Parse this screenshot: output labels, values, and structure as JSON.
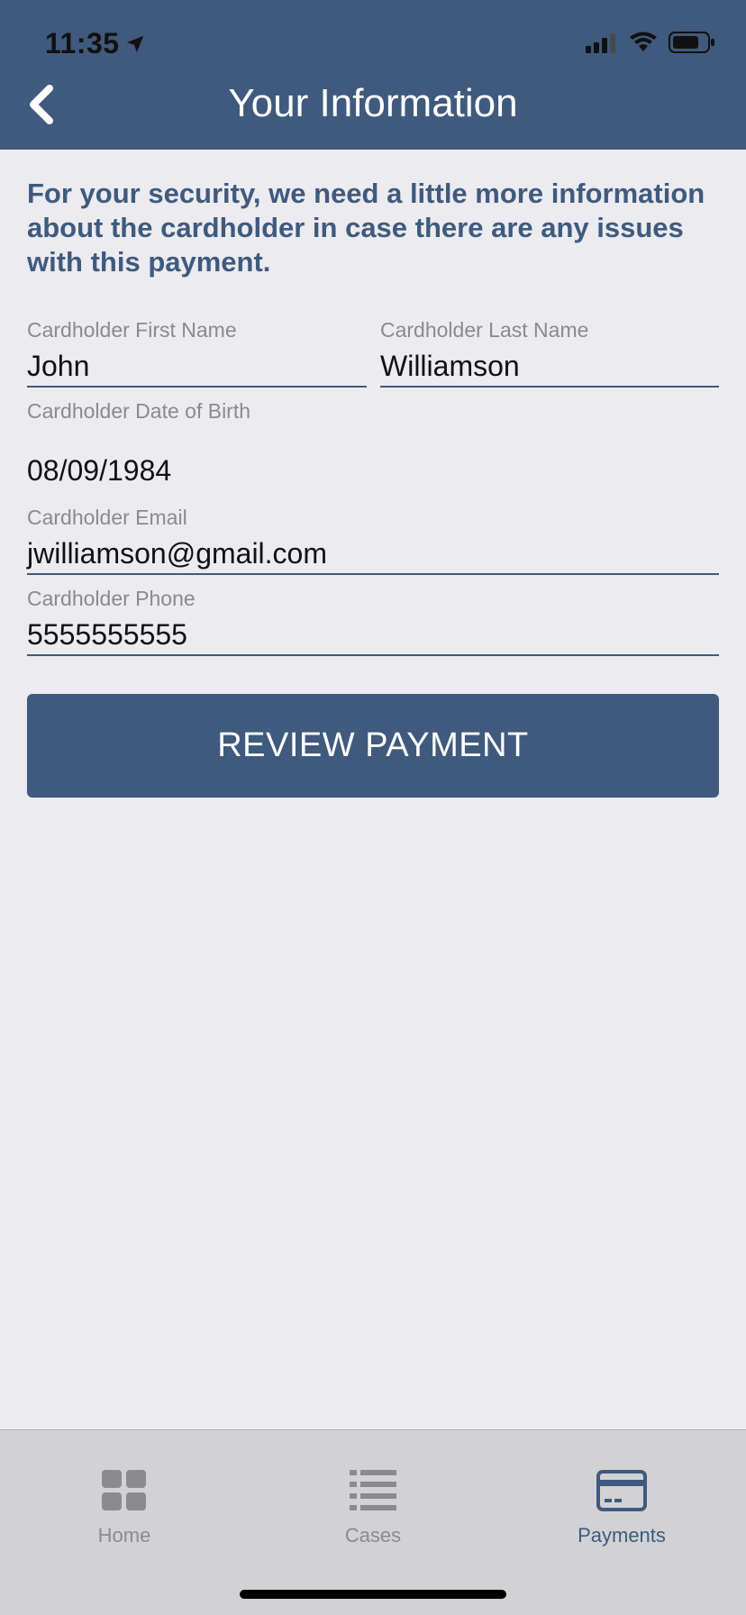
{
  "status_bar": {
    "time": "11:35"
  },
  "header": {
    "title": "Your Information"
  },
  "intro_text": "For your security, we need a little more information about the cardholder in case there are any issues with this payment.",
  "form": {
    "first_name": {
      "label": "Cardholder First Name",
      "value": "John"
    },
    "last_name": {
      "label": "Cardholder Last Name",
      "value": "Williamson"
    },
    "dob": {
      "label": "Cardholder Date of Birth",
      "value": "08/09/1984"
    },
    "email": {
      "label": "Cardholder Email",
      "value": "jwilliamson@gmail.com"
    },
    "phone": {
      "label": "Cardholder Phone",
      "value": "5555555555"
    }
  },
  "review_button": {
    "label": "REVIEW PAYMENT"
  },
  "tabs": [
    {
      "label": "Home",
      "icon": "grid-icon"
    },
    {
      "label": "Cases",
      "icon": "list-icon"
    },
    {
      "label": "Payments",
      "icon": "credit-card-icon",
      "active": true
    }
  ],
  "colors": {
    "primary": "#3f5a7d",
    "background": "#ebebf0",
    "tabbar": "#d2d2d4"
  }
}
